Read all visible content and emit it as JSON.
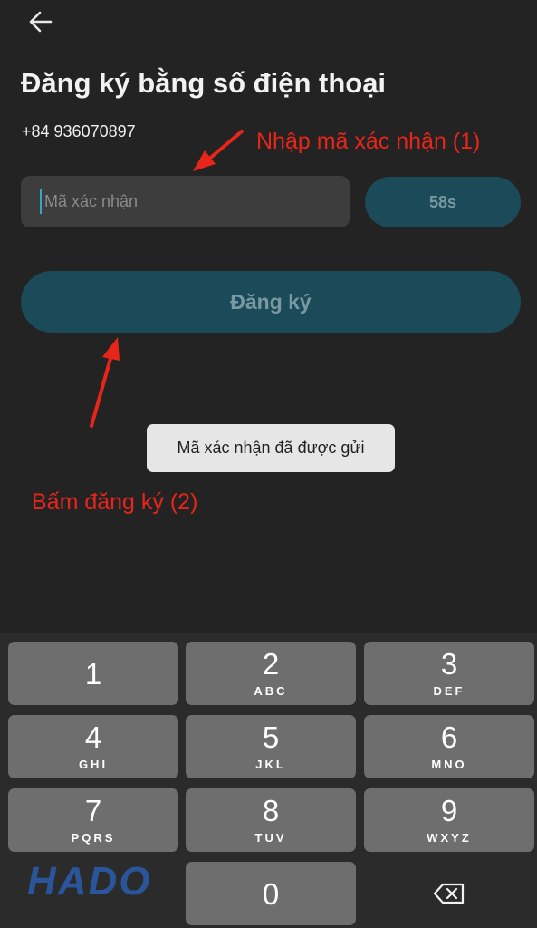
{
  "header": {
    "title": "Đăng ký bằng số điện thoại",
    "phone_number": "+84 936070897"
  },
  "form": {
    "code_placeholder": "Mã xác nhận",
    "code_value": "",
    "resend_countdown": "58s",
    "register_label": "Đăng ký"
  },
  "toast": {
    "message": "Mã xác nhận đã được gửi"
  },
  "annotations": {
    "step1": "Nhập mã xác nhận (1)",
    "step2": "Bấm đăng ký (2)",
    "color": "#e8251b"
  },
  "keyboard": {
    "keys": [
      {
        "digit": "1",
        "letters": ""
      },
      {
        "digit": "2",
        "letters": "ABC"
      },
      {
        "digit": "3",
        "letters": "DEF"
      },
      {
        "digit": "4",
        "letters": "GHI"
      },
      {
        "digit": "5",
        "letters": "JKL"
      },
      {
        "digit": "6",
        "letters": "MNO"
      },
      {
        "digit": "7",
        "letters": "PQRS"
      },
      {
        "digit": "8",
        "letters": "TUV"
      },
      {
        "digit": "9",
        "letters": "WXYZ"
      },
      {
        "digit": "0",
        "letters": ""
      }
    ],
    "delete_icon": "backspace-icon"
  },
  "watermark": {
    "text": "HADO"
  },
  "colors": {
    "background": "#232323",
    "accent_button": "#1b4a59",
    "key": "#6e6e6e"
  }
}
